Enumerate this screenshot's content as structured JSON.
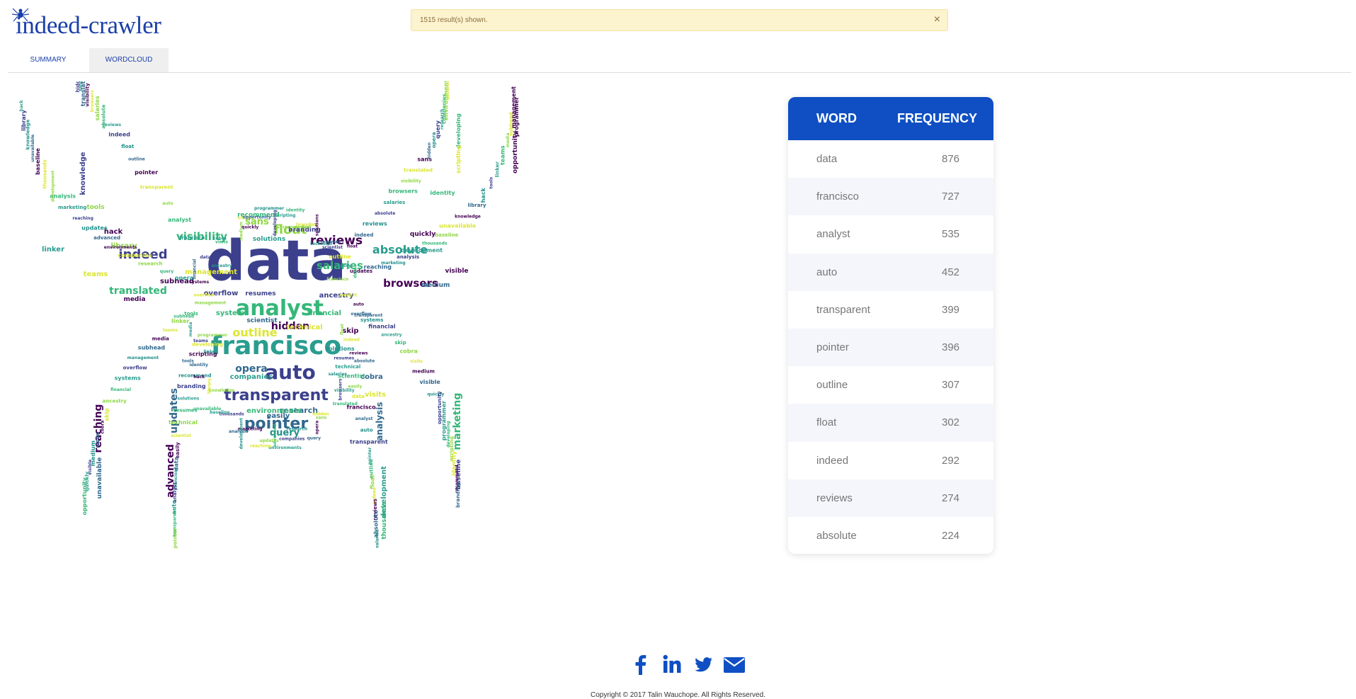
{
  "app": {
    "logo_text": "indeed-crawler"
  },
  "alert": {
    "message": "1515 result(s) shown.",
    "close_label": "×"
  },
  "tabs": [
    {
      "label": "SUMMARY",
      "active": false
    },
    {
      "label": "WORDCLOUD",
      "active": true
    }
  ],
  "frequency_table": {
    "headers": [
      "WORD",
      "FREQUENCY"
    ],
    "rows": [
      {
        "word": "data",
        "count": "876"
      },
      {
        "word": "francisco",
        "count": "727"
      },
      {
        "word": "analyst",
        "count": "535"
      },
      {
        "word": "auto",
        "count": "452"
      },
      {
        "word": "transparent",
        "count": "399"
      },
      {
        "word": "pointer",
        "count": "396"
      },
      {
        "word": "outline",
        "count": "307"
      },
      {
        "word": "float",
        "count": "302"
      },
      {
        "word": "indeed",
        "count": "292"
      },
      {
        "word": "reviews",
        "count": "274"
      },
      {
        "word": "absolute",
        "count": "224"
      }
    ]
  },
  "wordcloud": {
    "words": [
      "data",
      "francisco",
      "analyst",
      "auto",
      "transparent",
      "pointer",
      "outline",
      "float",
      "indeed",
      "reviews",
      "absolute",
      "salaries",
      "browsers",
      "visibility",
      "translated",
      "sans",
      "hidden",
      "opera",
      "query",
      "research",
      "companies",
      "environments",
      "advanced",
      "updates",
      "reaching",
      "marketing",
      "analysis",
      "development",
      "thousands",
      "baseline",
      "unavailable",
      "knowledge",
      "library",
      "hack",
      "tools",
      "linker",
      "teams",
      "media",
      "subhead",
      "management",
      "overflow",
      "systems",
      "financial",
      "ancestry",
      "skip",
      "cobra",
      "visits",
      "medium",
      "visible",
      "quickly",
      "opportunity",
      "programmer",
      "developing",
      "scripting",
      "identity",
      "recommend",
      "branding",
      "solutions",
      "resumes",
      "technical",
      "scientist",
      "easily"
    ],
    "palette": [
      "#3b3f8c",
      "#2a9d8f",
      "#35b779",
      "#8fd744",
      "#dbe632",
      "#440154",
      "#31688e",
      "#21918c"
    ]
  },
  "social": [
    "facebook-icon",
    "linkedin-icon",
    "twitter-icon",
    "email-icon"
  ],
  "footer": {
    "copyright": "Copyright © 2017 Talin Wauchope. All Rights Reserved."
  }
}
